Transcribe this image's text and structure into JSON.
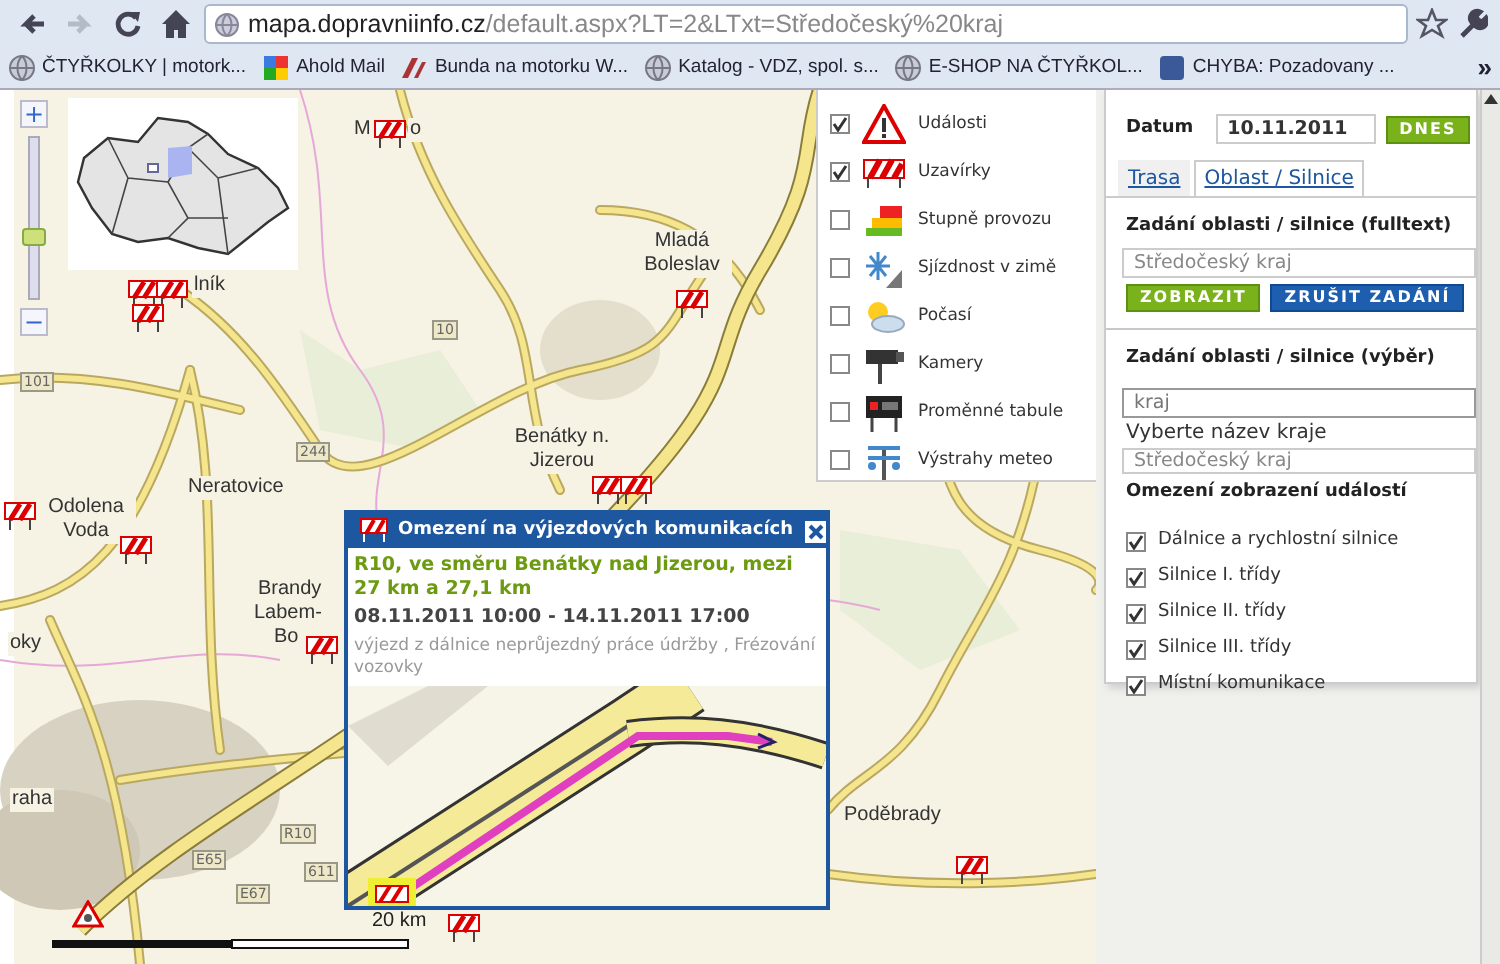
{
  "browser": {
    "nav_buttons": [
      {
        "kind": "back",
        "disabled": false
      },
      {
        "kind": "forward",
        "disabled": true
      },
      {
        "kind": "reload",
        "disabled": false
      },
      {
        "kind": "home",
        "disabled": false
      }
    ],
    "address": {
      "host": "mapa.dopravniinfo.cz",
      "path": "/default.aspx?LT=2&LTxt=Středočeský%20kraj"
    },
    "bookmarks": [
      {
        "label": "ČTYŘKOLKY | motork...",
        "kind": "globe"
      },
      {
        "label": "Ahold Mail",
        "kind": "tiles"
      },
      {
        "label": "Bunda na motorku W...",
        "kind": "logo"
      },
      {
        "label": "Katalog - VDZ, spol. s...",
        "kind": "globe"
      },
      {
        "label": "E-SHOP NA ČTYŘKOL...",
        "kind": "globe"
      },
      {
        "label": "CHYBA: Pozadovany ...",
        "kind": "square"
      }
    ],
    "more": "»"
  },
  "map": {
    "places": [
      {
        "text": "M"
      },
      {
        "text": "o"
      },
      {
        "text": "lník"
      },
      {
        "text": "Mladá Boleslav"
      },
      {
        "text": "Benátky n. Jizerou"
      },
      {
        "text": "Neratovice"
      },
      {
        "text": "Odolena Voda"
      },
      {
        "text": "Brandy"
      },
      {
        "text": "Labem-"
      },
      {
        "text": "Bo"
      },
      {
        "text": "oky"
      },
      {
        "text": "raha"
      },
      {
        "text": "Poděbrady"
      }
    ],
    "road_numbers": [
      "10",
      "101",
      "244",
      "R10",
      "E67",
      "611",
      "E65"
    ],
    "zoom": {
      "plus": "+",
      "minus": "−",
      "level": 0.35
    },
    "scale": "20 km"
  },
  "layers": [
    {
      "label": "Události",
      "checked": true,
      "kind": "warning"
    },
    {
      "label": "Uzavírky",
      "checked": true,
      "kind": "closure"
    },
    {
      "label": "Stupně provozu",
      "checked": false,
      "kind": "traffic"
    },
    {
      "label": "Sjízdnost v zimě",
      "checked": false,
      "kind": "snow"
    },
    {
      "label": "Počasí",
      "checked": false,
      "kind": "weather"
    },
    {
      "label": "Kamery",
      "checked": false,
      "kind": "camera"
    },
    {
      "label": "Proměnné tabule",
      "checked": false,
      "kind": "board"
    },
    {
      "label": "Výstrahy meteo",
      "checked": false,
      "kind": "meteo"
    }
  ],
  "popup": {
    "title": "Omezení na výjezdových komunikacích",
    "location": "R10, ve směru Benátky nad Jizerou, mezi 27 km a 27,1 km",
    "time": "08.11.2011 10:00 - 14.11.2011 17:00",
    "description": "výjezd z dálnice neprůjezdný práce údržby , Frézování vozovky"
  },
  "panel": {
    "date_label": "Datum",
    "date_value": "10.11.2011",
    "today_button": "DNES",
    "tabs": [
      {
        "label": "Trasa",
        "selected": false
      },
      {
        "label": "Oblast / Silnice",
        "selected": true
      }
    ],
    "fulltext_heading": "Zadání oblasti / silnice (fulltext)",
    "fulltext_value": "Středočeský kraj",
    "show_button": "ZOBRAZIT",
    "cancel_button": "ZRUŠIT ZADÁNÍ",
    "select_heading": "Zadání oblasti / silnice (výběr)",
    "kraj_value": "kraj",
    "kraj_label": "Vyberte název kraje",
    "kraj_select": "Středočeský kraj",
    "filter_heading": "Omezení zobrazení událostí",
    "filters": [
      {
        "label": "Dálnice a rychlostní silnice",
        "checked": true
      },
      {
        "label": "Silnice I. třídy",
        "checked": true
      },
      {
        "label": "Silnice II. třídy",
        "checked": true
      },
      {
        "label": "Silnice III. třídy",
        "checked": true
      },
      {
        "label": "Místní komunikace",
        "checked": true
      }
    ]
  }
}
